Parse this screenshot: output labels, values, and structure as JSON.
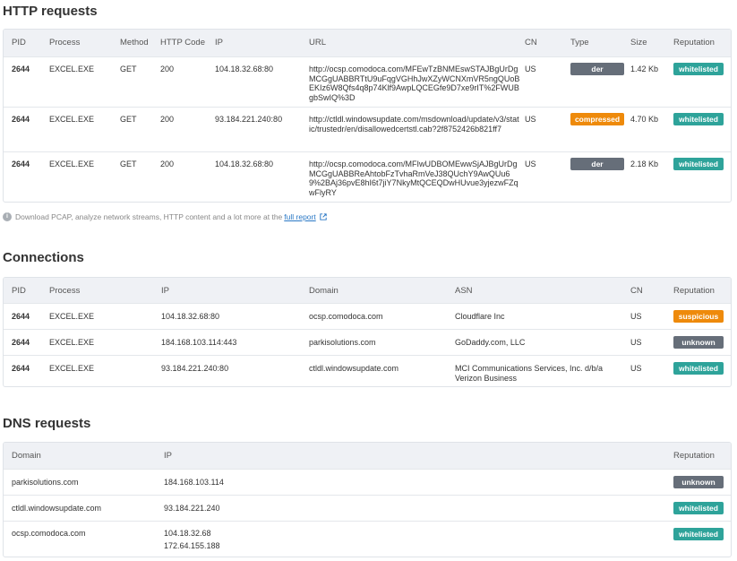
{
  "http": {
    "title": "HTTP requests",
    "headers": [
      "PID",
      "Process",
      "Method",
      "HTTP Code",
      "IP",
      "URL",
      "CN",
      "Type",
      "Size",
      "Reputation"
    ],
    "rows": [
      {
        "pid": "2644",
        "process": "EXCEL.EXE",
        "method": "GET",
        "code": "200",
        "ip": "104.18.32.68:80",
        "url": "http://ocsp.comodoca.com/MFEwTzBNMEswSTAJBgUrDgMCGgUABBRTtU9uFqgVGHhJwXZyWCNXmVR5ngQUoBEKIz6W8Qfs4q8p74Klf9AwpLQCEGfe9D7xe9rIT%2FWUBgbSwIQ%3D",
        "cn": "US",
        "type": "der",
        "size": "1.42 Kb",
        "reputation": "whitelisted"
      },
      {
        "pid": "2644",
        "process": "EXCEL.EXE",
        "method": "GET",
        "code": "200",
        "ip": "93.184.221.240:80",
        "url": "http://ctldl.windowsupdate.com/msdownload/update/v3/static/trustedr/en/disallowedcertstl.cab?2f8752426b821ff7",
        "cn": "US",
        "type": "compressed",
        "size": "4.70 Kb",
        "reputation": "whitelisted"
      },
      {
        "pid": "2644",
        "process": "EXCEL.EXE",
        "method": "GET",
        "code": "200",
        "ip": "104.18.32.68:80",
        "url": "http://ocsp.comodoca.com/MFIwUDBOMEwwSjAJBgUrDgMCGgUABBReAhtobFzTvhaRmVeJ38QUchY9AwQUu69%2BAj36pvE8hI6t7jiY7NkyMtQCEQDwHUvue3yjezwFZqwFlyRY",
        "cn": "US",
        "type": "der",
        "size": "2.18 Kb",
        "reputation": "whitelisted"
      }
    ]
  },
  "note": {
    "text": "Download PCAP, analyze network streams, HTTP content and a lot more at the",
    "link": "full report",
    "info_icon": "i"
  },
  "connections": {
    "title": "Connections",
    "headers": [
      "PID",
      "Process",
      "IP",
      "Domain",
      "ASN",
      "CN",
      "Reputation"
    ],
    "rows": [
      {
        "pid": "2644",
        "process": "EXCEL.EXE",
        "ip": "104.18.32.68:80",
        "domain": "ocsp.comodoca.com",
        "asn": "Cloudflare Inc",
        "cn": "US",
        "reputation": "suspicious"
      },
      {
        "pid": "2644",
        "process": "EXCEL.EXE",
        "ip": "184.168.103.114:443",
        "domain": "parkisolutions.com",
        "asn": "GoDaddy.com, LLC",
        "cn": "US",
        "reputation": "unknown"
      },
      {
        "pid": "2644",
        "process": "EXCEL.EXE",
        "ip": "93.184.221.240:80",
        "domain": "ctldl.windowsupdate.com",
        "asn": "MCI Communications Services, Inc. d/b/a Verizon Business",
        "cn": "US",
        "reputation": "whitelisted"
      }
    ]
  },
  "dns": {
    "title": "DNS requests",
    "headers": [
      "Domain",
      "IP",
      "Reputation"
    ],
    "rows": [
      {
        "domain": "parkisolutions.com",
        "ip1": "184.168.103.114",
        "ip2": "",
        "reputation": "unknown"
      },
      {
        "domain": "ctldl.windowsupdate.com",
        "ip1": "93.184.221.240",
        "ip2": "",
        "reputation": "whitelisted"
      },
      {
        "domain": "ocsp.comodoca.com",
        "ip1": "104.18.32.68",
        "ip2": "172.64.155.188",
        "reputation": "whitelisted"
      }
    ]
  },
  "colors": {
    "badge_gray": "#666e79",
    "badge_orange": "#ee8a0b",
    "badge_teal": "#2ea39a",
    "link": "#2a78c5"
  }
}
